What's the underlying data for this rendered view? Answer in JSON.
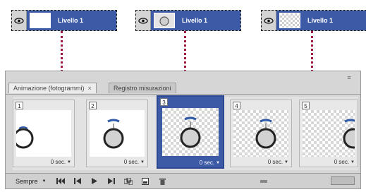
{
  "layers": [
    {
      "name": "Livello 1",
      "thumb": "white",
      "icon": "eye-icon"
    },
    {
      "name": "Livello 1",
      "thumb": "circle",
      "icon": "eye-icon"
    },
    {
      "name": "Livello 1",
      "thumb": "checker",
      "icon": "eye-icon"
    }
  ],
  "panel": {
    "tab_active": "Animazione (fotogrammi)",
    "tab_close": "×",
    "tab_inactive": "Registro misurazioni",
    "menu_icon": "panel-menu-icon"
  },
  "frames": [
    {
      "number": "1",
      "delay": "0 sec.",
      "selected": false,
      "background": "white"
    },
    {
      "number": "2",
      "delay": "0 sec.",
      "selected": false,
      "background": "white"
    },
    {
      "number": "3",
      "delay": "0 sec.",
      "selected": true,
      "background": "checker"
    },
    {
      "number": "4",
      "delay": "0 sec.",
      "selected": false,
      "background": "checker"
    },
    {
      "number": "5",
      "delay": "0 sec.",
      "selected": false,
      "background": "checker"
    }
  ],
  "toolbar": {
    "loop_label": "Sempre",
    "dropdown_icon": "triangle-down-icon"
  },
  "colors": {
    "selection_blue": "#3d5aa6",
    "connector": "#a01840"
  }
}
